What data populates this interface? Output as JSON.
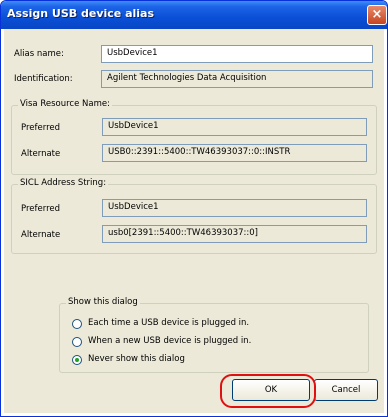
{
  "window": {
    "title": "Assign USB device alias"
  },
  "alias": {
    "label": "Alias name:",
    "value": "UsbDevice1"
  },
  "identification": {
    "label": "Identification:",
    "value": "Agilent Technologies Data Acquisition"
  },
  "visa": {
    "title": "Visa Resource Name:",
    "preferred_label": "Preferred",
    "preferred_value": "UsbDevice1",
    "alternate_label": "Alternate",
    "alternate_value": "USB0::2391::5400::TW46393037::0::INSTR"
  },
  "sicl": {
    "title": "SICL Address String:",
    "preferred_label": "Preferred",
    "preferred_value": "UsbDevice1",
    "alternate_label": "Alternate",
    "alternate_value": "usb0[2391::5400::TW46393037::0]"
  },
  "show_dialog": {
    "title": "Show this dialog",
    "options": [
      {
        "label": "Each time a USB device is plugged in.",
        "selected": false
      },
      {
        "label": "When a new USB device is plugged in.",
        "selected": false
      },
      {
        "label": "Never show this dialog",
        "selected": true
      }
    ]
  },
  "buttons": {
    "ok": "OK",
    "cancel": "Cancel"
  },
  "icons": {
    "close": "close-icon",
    "radio": "radio-button"
  },
  "colors": {
    "titlebar": "#0a4fd6",
    "dialog_bg": "#ece9d8",
    "highlight_ring": "#e01010"
  }
}
